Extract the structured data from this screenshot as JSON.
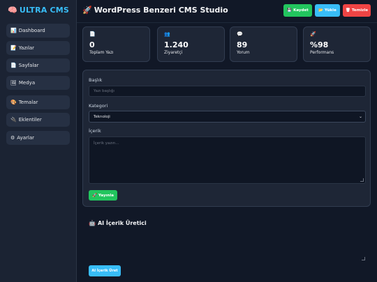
{
  "sidebar": {
    "brand_icon": "🧠",
    "brand": "ULTRA CMS",
    "items": [
      {
        "icon": "📊",
        "label": "Dashboard"
      },
      {
        "icon": "📝",
        "label": "Yazılar"
      },
      {
        "icon": "📄",
        "label": "Sayfalar"
      },
      {
        "icon": "🖼",
        "label": "Medya"
      },
      {
        "icon": "🎨",
        "label": "Temalar"
      },
      {
        "icon": "🔌",
        "label": "Eklentiler"
      },
      {
        "icon": "⚙",
        "label": "Ayarlar"
      }
    ]
  },
  "header": {
    "icon": "🚀",
    "title": "WordPress Benzeri CMS Studio",
    "buttons": [
      {
        "icon": "💾",
        "label": "Kaydet",
        "color": "#22c55e"
      },
      {
        "icon": "📂",
        "label": "Yükle",
        "color": "#38bdf8"
      },
      {
        "icon": "🗑",
        "label": "Temizle",
        "color": "#ef4444"
      }
    ]
  },
  "stats": [
    {
      "icon": "📄",
      "value": "0",
      "label": "Toplam Yazı"
    },
    {
      "icon": "👥",
      "value": "1.240",
      "label": "Ziyaretçi"
    },
    {
      "icon": "💬",
      "value": "89",
      "label": "Yorum"
    },
    {
      "icon": "🚀",
      "value": "%98",
      "label": "Performans"
    }
  ],
  "editor": {
    "title_label": "Başlık",
    "title_placeholder": "Yazı başlığı",
    "category_label": "Kategori",
    "category_value": "Teknoloji",
    "content_label": "İçerik",
    "content_placeholder": "İçerik yazın...",
    "publish_icon": "🚀",
    "publish_label": "Yayınla"
  },
  "ai": {
    "icon": "🤖",
    "title": "AI İçerik Üretici",
    "button_label": "AI İçerik Üret"
  },
  "colors": {
    "background": "#111827",
    "panel": "#1e2636",
    "accent": "#38bdf8",
    "success": "#22c55e",
    "danger": "#ef4444"
  }
}
